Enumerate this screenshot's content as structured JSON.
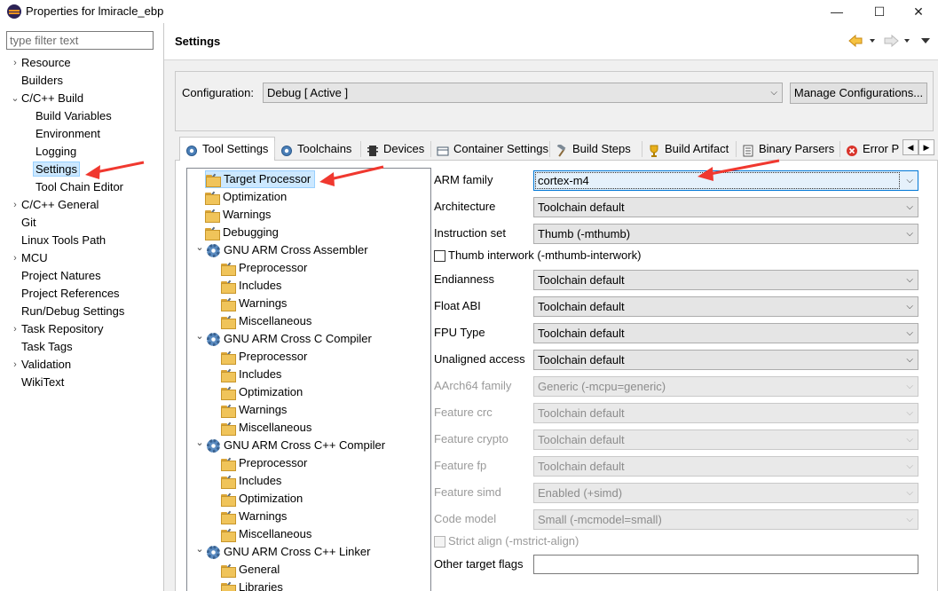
{
  "window": {
    "title": "Properties for lmiracle_ebp",
    "minimize": "—",
    "maximize": "☐",
    "close": "✕"
  },
  "filter": {
    "placeholder": "type filter text"
  },
  "nav": [
    {
      "label": "Resource",
      "chevron": "›"
    },
    {
      "label": "Builders",
      "chevron": ""
    },
    {
      "label": "C/C++ Build",
      "chevron": "⌄"
    },
    {
      "label": "Build Variables",
      "chevron": ""
    },
    {
      "label": "Environment",
      "chevron": ""
    },
    {
      "label": "Logging",
      "chevron": ""
    },
    {
      "label": "Settings",
      "chevron": "",
      "selected": true
    },
    {
      "label": "Tool Chain Editor",
      "chevron": ""
    },
    {
      "label": "C/C++ General",
      "chevron": "›"
    },
    {
      "label": "Git",
      "chevron": ""
    },
    {
      "label": "Linux Tools Path",
      "chevron": ""
    },
    {
      "label": "MCU",
      "chevron": "›"
    },
    {
      "label": "Project Natures",
      "chevron": ""
    },
    {
      "label": "Project References",
      "chevron": ""
    },
    {
      "label": "Run/Debug Settings",
      "chevron": ""
    },
    {
      "label": "Task Repository",
      "chevron": "›"
    },
    {
      "label": "Task Tags",
      "chevron": ""
    },
    {
      "label": "Validation",
      "chevron": "›"
    },
    {
      "label": "WikiText",
      "chevron": ""
    }
  ],
  "header": {
    "title": "Settings"
  },
  "configuration": {
    "label": "Configuration:",
    "value": "Debug  [ Active ]",
    "manage_button": "Manage Configurations..."
  },
  "tabs": [
    {
      "label": "Tool Settings",
      "icon": "gear-icon",
      "active": true
    },
    {
      "label": "Toolchains",
      "icon": "gear-icon"
    },
    {
      "label": "Devices",
      "icon": "chip-icon"
    },
    {
      "label": "Container Settings",
      "icon": "container-icon"
    },
    {
      "label": "Build Steps",
      "icon": "hammer-icon"
    },
    {
      "label": "Build Artifact",
      "icon": "trophy-icon"
    },
    {
      "label": "Binary Parsers",
      "icon": "binary-icon"
    },
    {
      "label": "Error P",
      "icon": "error-icon"
    }
  ],
  "tree": [
    {
      "label": "Target Processor",
      "type": "folder",
      "selected": true
    },
    {
      "label": "Optimization",
      "type": "folder"
    },
    {
      "label": "Warnings",
      "type": "folder"
    },
    {
      "label": "Debugging",
      "type": "folder"
    },
    {
      "label": "GNU ARM Cross Assembler",
      "type": "tool"
    },
    {
      "label": "Preprocessor",
      "type": "folder"
    },
    {
      "label": "Includes",
      "type": "folder"
    },
    {
      "label": "Warnings",
      "type": "folder"
    },
    {
      "label": "Miscellaneous",
      "type": "folder"
    },
    {
      "label": "GNU ARM Cross C Compiler",
      "type": "tool"
    },
    {
      "label": "Preprocessor",
      "type": "folder"
    },
    {
      "label": "Includes",
      "type": "folder"
    },
    {
      "label": "Optimization",
      "type": "folder"
    },
    {
      "label": "Warnings",
      "type": "folder"
    },
    {
      "label": "Miscellaneous",
      "type": "folder"
    },
    {
      "label": "GNU ARM Cross C++ Compiler",
      "type": "tool"
    },
    {
      "label": "Preprocessor",
      "type": "folder"
    },
    {
      "label": "Includes",
      "type": "folder"
    },
    {
      "label": "Optimization",
      "type": "folder"
    },
    {
      "label": "Warnings",
      "type": "folder"
    },
    {
      "label": "Miscellaneous",
      "type": "folder"
    },
    {
      "label": "GNU ARM Cross C++ Linker",
      "type": "tool"
    },
    {
      "label": "General",
      "type": "folder"
    },
    {
      "label": "Libraries",
      "type": "folder"
    }
  ],
  "options": [
    {
      "label": "ARM family",
      "value": "cortex-m4",
      "enabled": true
    },
    {
      "label": "Architecture",
      "value": "Toolchain default",
      "enabled": true
    },
    {
      "label": "Instruction set",
      "value": "Thumb (-mthumb)",
      "enabled": true
    },
    {
      "label": "Thumb interwork (-mthumb-interwork)",
      "type": "checkbox",
      "checked": false,
      "enabled": true
    },
    {
      "label": "Endianness",
      "value": "Toolchain default",
      "enabled": true
    },
    {
      "label": "Float ABI",
      "value": "Toolchain default",
      "enabled": true
    },
    {
      "label": "FPU Type",
      "value": "Toolchain default",
      "enabled": true
    },
    {
      "label": "Unaligned access",
      "value": "Toolchain default",
      "enabled": true
    },
    {
      "label": "AArch64 family",
      "value": "Generic (-mcpu=generic)",
      "enabled": false
    },
    {
      "label": "Feature crc",
      "value": "Toolchain default",
      "enabled": false
    },
    {
      "label": "Feature crypto",
      "value": "Toolchain default",
      "enabled": false
    },
    {
      "label": "Feature fp",
      "value": "Toolchain default",
      "enabled": false
    },
    {
      "label": "Feature simd",
      "value": "Enabled (+simd)",
      "enabled": false
    },
    {
      "label": "Code model",
      "value": "Small (-mcmodel=small)",
      "enabled": false
    },
    {
      "label": "Strict align (-mstrict-align)",
      "type": "checkbox",
      "checked": false,
      "enabled": false
    },
    {
      "label": "Other target flags",
      "type": "text",
      "value": "",
      "enabled": true
    }
  ],
  "colors": {
    "annotation_arrow": "#f0382f",
    "selection": "#cce8ff",
    "back_arrow": "#e8a317"
  }
}
